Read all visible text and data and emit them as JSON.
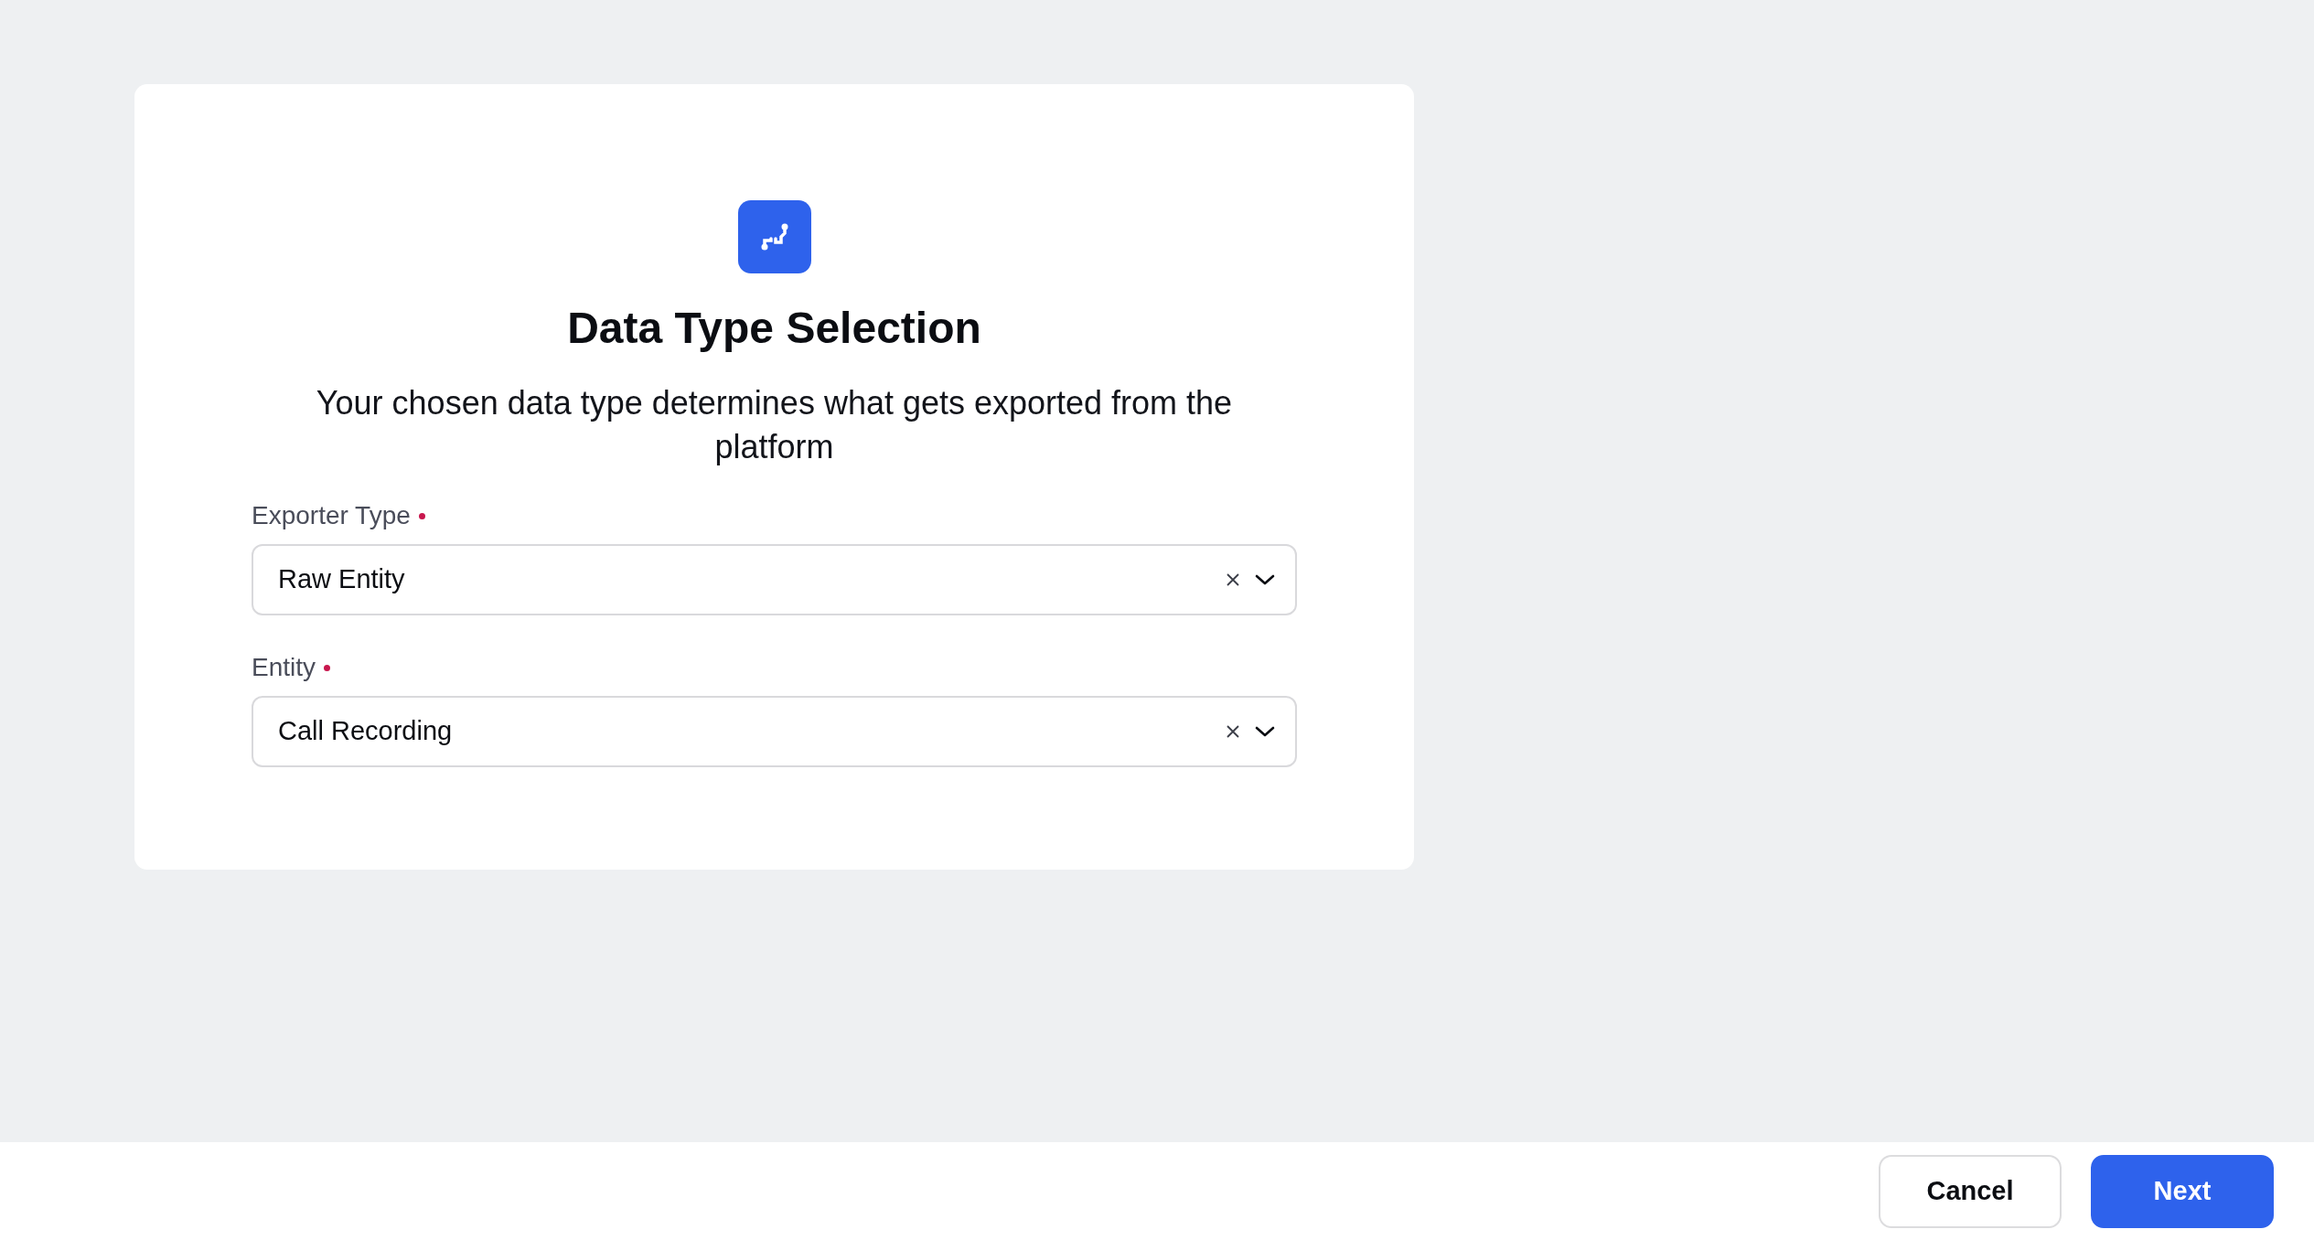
{
  "dialog": {
    "title": "Data Type Selection",
    "description": "Your chosen data type determines what gets exported from the platform",
    "fields": [
      {
        "label": "Exporter Type",
        "required": true,
        "value": "Raw Entity"
      },
      {
        "label": "Entity",
        "required": true,
        "value": "Call Recording"
      }
    ]
  },
  "footer": {
    "buttons": [
      {
        "label": "Cancel",
        "kind": "secondary"
      },
      {
        "label": "Next",
        "kind": "primary"
      }
    ]
  }
}
